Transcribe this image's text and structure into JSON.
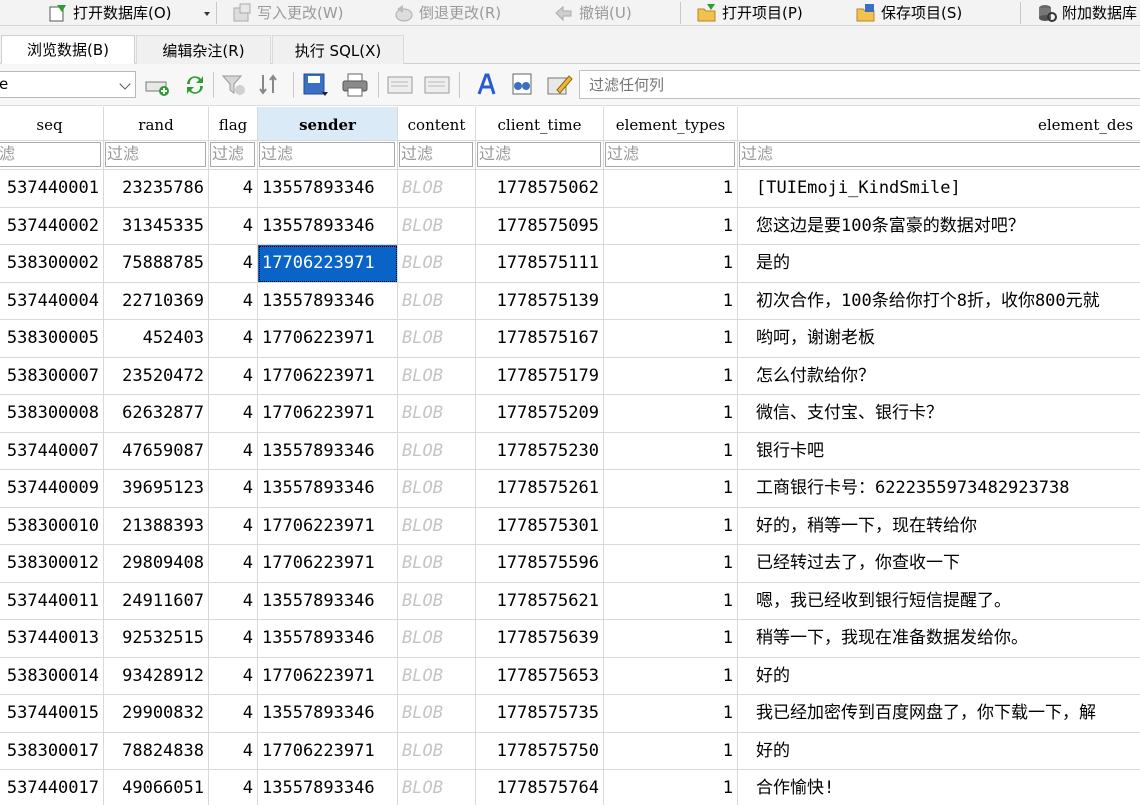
{
  "toolbar": {
    "open_db": "打开数据库(O)",
    "write_changes": "写入更改(W)",
    "revert_changes": "倒退更改(R)",
    "undo": "撤销(U)",
    "open_project": "打开项目(P)",
    "save_project": "保存项目(S)",
    "attach_db": "附加数据库"
  },
  "tabs": [
    "浏览数据(B)",
    "编辑杂注(R)",
    "执行 SQL(X)"
  ],
  "table_select": {
    "value": "e"
  },
  "filter_any": {
    "placeholder": "过滤任何列"
  },
  "grid": {
    "columns": [
      "seq",
      "rand",
      "flag",
      "sender",
      "content",
      "client_time",
      "element_types",
      "element_des"
    ],
    "column_filter_placeholders": [
      "滤",
      "过滤",
      "过滤",
      "过滤",
      "过滤",
      "过滤",
      "过滤",
      "过滤"
    ],
    "sorted_column": "sender",
    "selected": {
      "row": 2,
      "column": "sender"
    },
    "rows": [
      [
        "537440001",
        "23235786",
        "4",
        "13557893346",
        "BLOB",
        "1778575062",
        "1",
        "[TUIEmoji_KindSmile]"
      ],
      [
        "537440002",
        "31345335",
        "4",
        "13557893346",
        "BLOB",
        "1778575095",
        "1",
        "您这边是要100条富豪的数据对吧？"
      ],
      [
        "538300002",
        "75888785",
        "4",
        "17706223971",
        "BLOB",
        "1778575111",
        "1",
        "是的"
      ],
      [
        "537440004",
        "22710369",
        "4",
        "13557893346",
        "BLOB",
        "1778575139",
        "1",
        "初次合作，100条给你打个8折，收你800元就"
      ],
      [
        "538300005",
        "452403",
        "4",
        "17706223971",
        "BLOB",
        "1778575167",
        "1",
        "哟呵，谢谢老板"
      ],
      [
        "538300007",
        "23520472",
        "4",
        "17706223971",
        "BLOB",
        "1778575179",
        "1",
        "怎么付款给你？"
      ],
      [
        "538300008",
        "62632877",
        "4",
        "17706223971",
        "BLOB",
        "1778575209",
        "1",
        "微信、支付宝、银行卡？"
      ],
      [
        "537440007",
        "47659087",
        "4",
        "13557893346",
        "BLOB",
        "1778575230",
        "1",
        "银行卡吧"
      ],
      [
        "537440009",
        "39695123",
        "4",
        "13557893346",
        "BLOB",
        "1778575261",
        "1",
        "工商银行卡号：6222355973482923738"
      ],
      [
        "538300010",
        "21388393",
        "4",
        "17706223971",
        "BLOB",
        "1778575301",
        "1",
        "好的，稍等一下，现在转给你"
      ],
      [
        "538300012",
        "29809408",
        "4",
        "17706223971",
        "BLOB",
        "1778575596",
        "1",
        "已经转过去了，你查收一下"
      ],
      [
        "537440011",
        "24911607",
        "4",
        "13557893346",
        "BLOB",
        "1778575621",
        "1",
        "嗯，我已经收到银行短信提醒了。"
      ],
      [
        "537440013",
        "92532515",
        "4",
        "13557893346",
        "BLOB",
        "1778575639",
        "1",
        "稍等一下，我现在准备数据发给你。"
      ],
      [
        "538300014",
        "93428912",
        "4",
        "17706223971",
        "BLOB",
        "1778575653",
        "1",
        "好的"
      ],
      [
        "537440015",
        "29900832",
        "4",
        "13557893346",
        "BLOB",
        "1778575735",
        "1",
        "我已经加密传到百度网盘了，你下载一下，解"
      ],
      [
        "538300017",
        "78824838",
        "4",
        "17706223971",
        "BLOB",
        "1778575750",
        "1",
        "好的"
      ],
      [
        "537440017",
        "49066051",
        "4",
        "13557893346",
        "BLOB",
        "1778575764",
        "1",
        "合作愉快!"
      ]
    ]
  }
}
